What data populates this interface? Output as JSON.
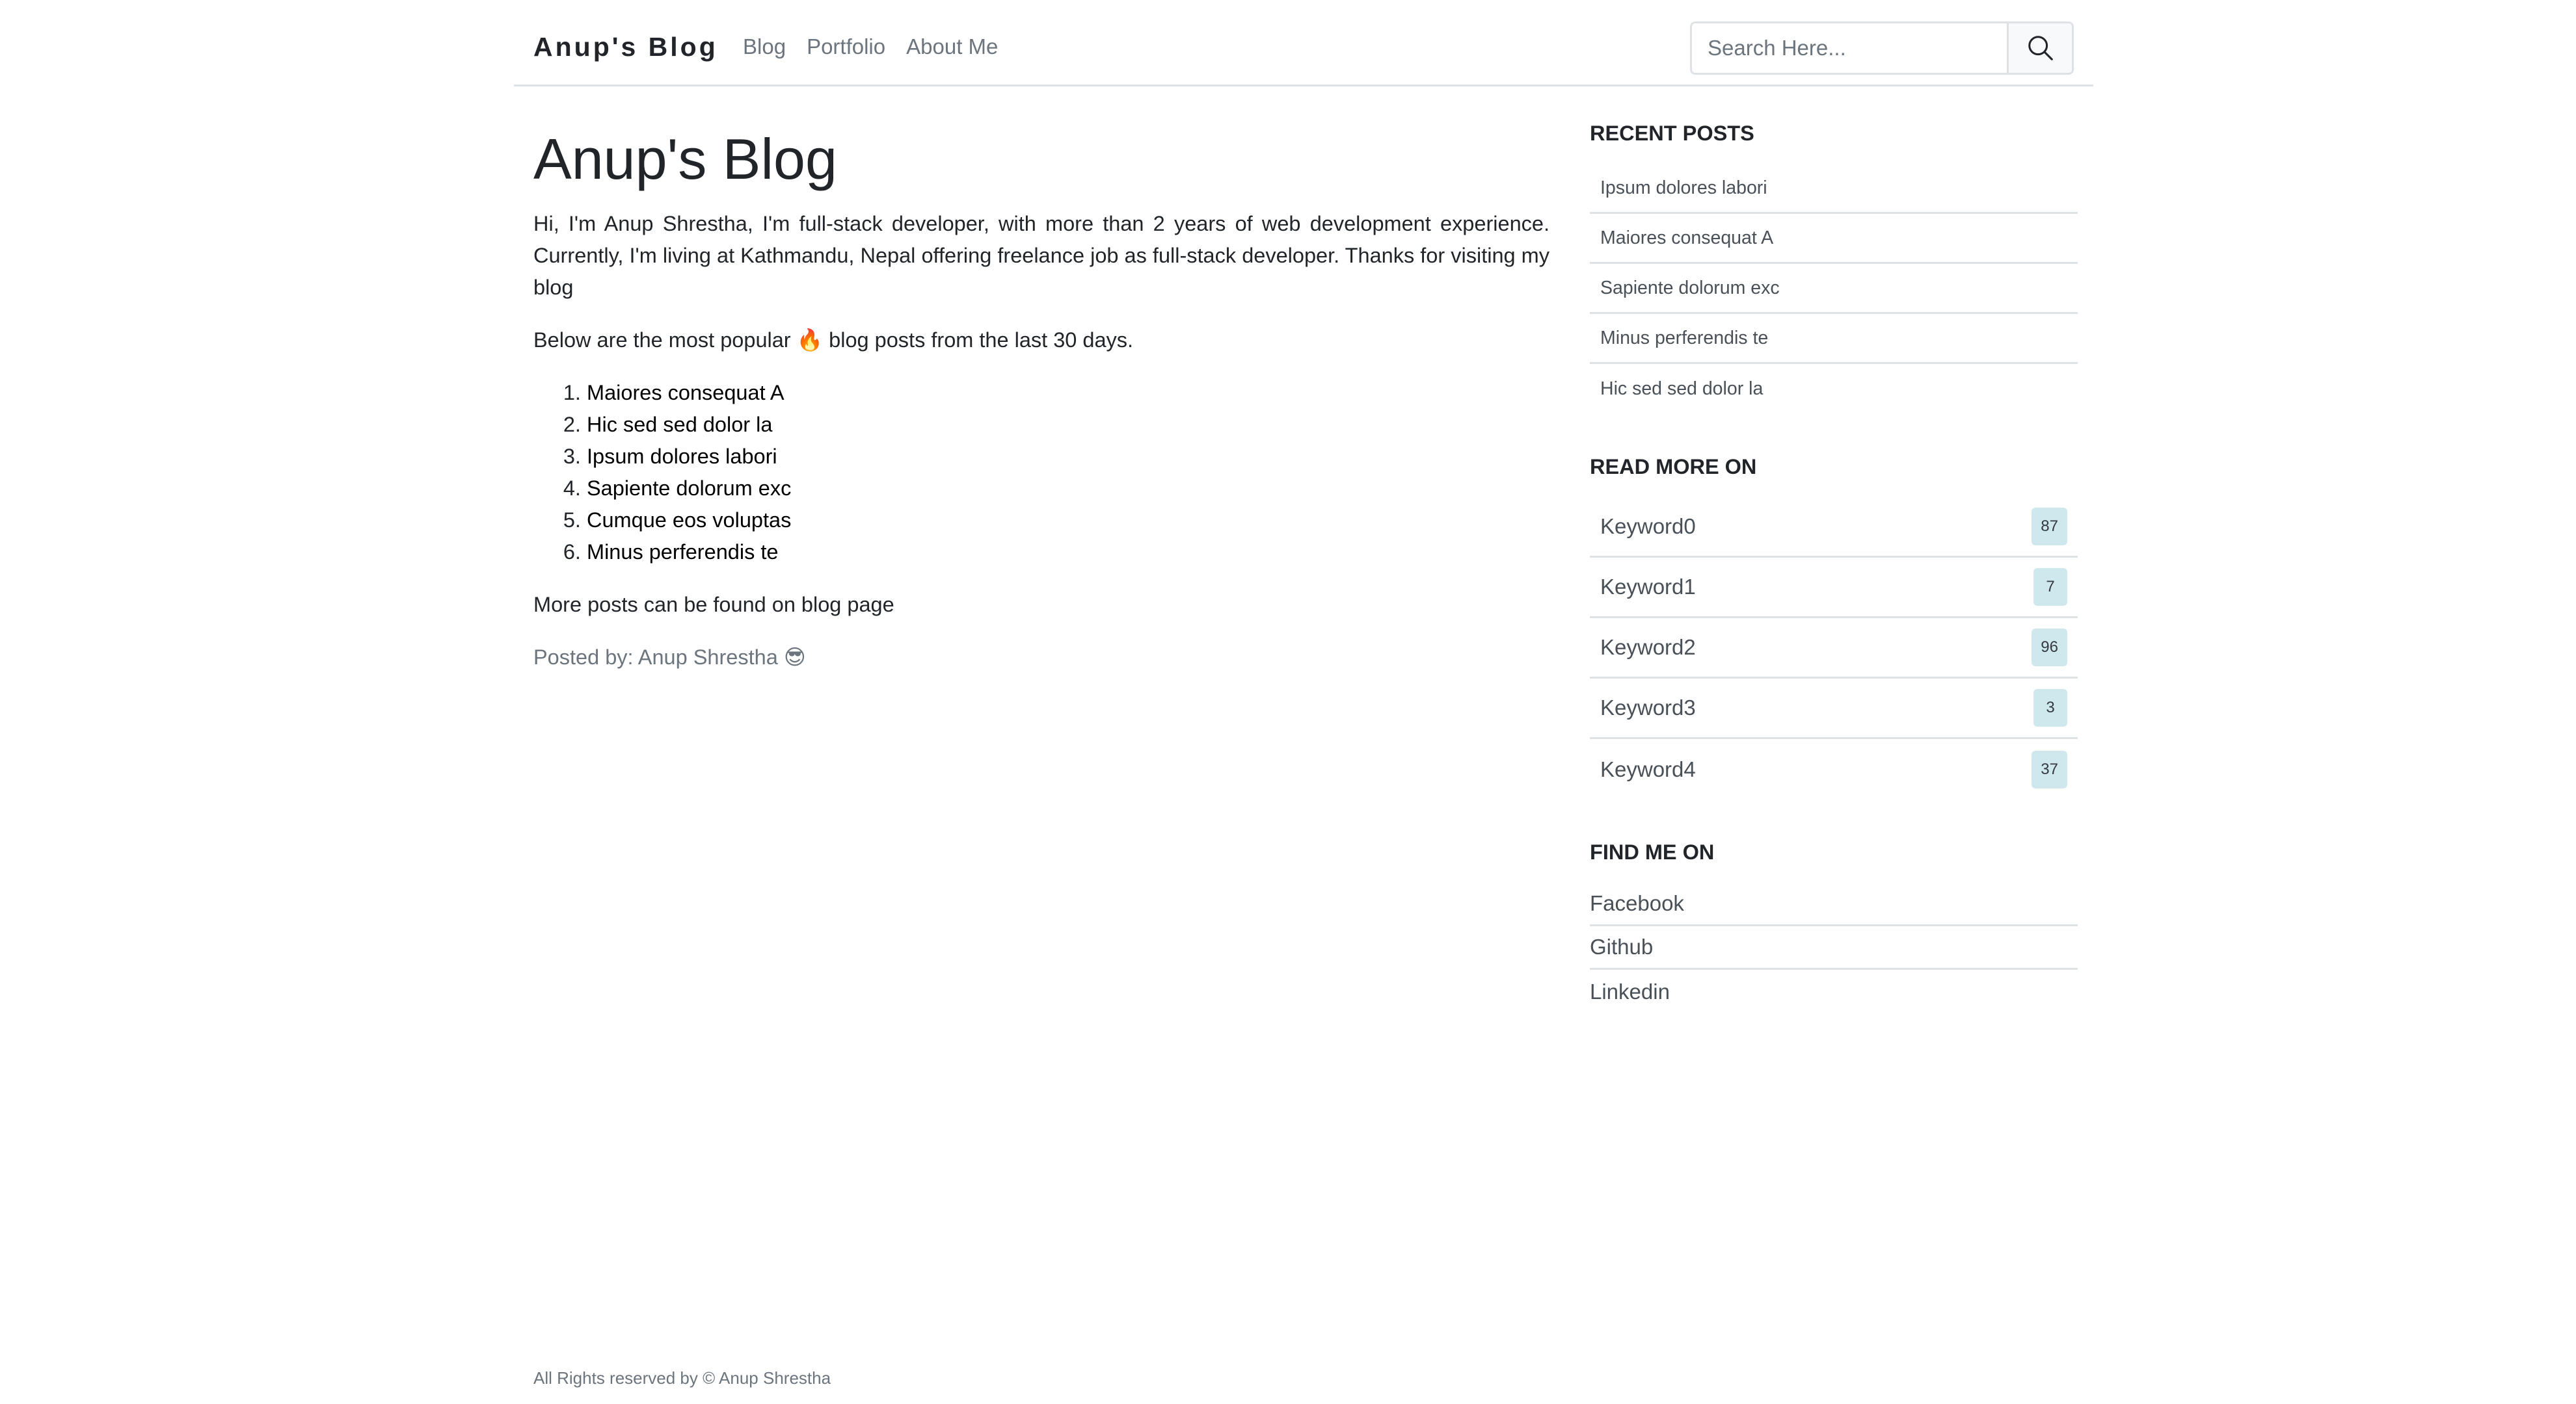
{
  "navbar": {
    "brand": "Anup's Blog",
    "links": [
      "Blog",
      "Portfolio",
      "About Me"
    ],
    "search_placeholder": "Search Here..."
  },
  "main": {
    "title": "Anup's Blog",
    "intro": "Hi, I'm Anup Shrestha, I'm full-stack developer, with more than 2 years of web development experience. Currently, I'm living at Kathmandu, Nepal offering freelance job as full-stack developer. Thanks for visiting my blog",
    "popular_before": "Below are the most popular ",
    "popular_emoji": "🔥",
    "popular_after": " blog posts from the last 30 days.",
    "popular_posts": [
      "Maiores consequat A",
      "Hic sed sed dolor la",
      "Ipsum dolores labori",
      "Sapiente dolorum exc",
      "Cumque eos voluptas",
      "Minus perferendis te"
    ],
    "more_posts": "More posts can be found on blog page",
    "posted_by": "Posted by: Anup Shrestha",
    "posted_by_emoji": "😎"
  },
  "sidebar": {
    "recent_heading": "RECENT POSTS",
    "recent_posts": [
      "Ipsum dolores labori",
      "Maiores consequat A",
      "Sapiente dolorum exc",
      "Minus perferendis te",
      "Hic sed sed dolor la"
    ],
    "read_more_heading": "READ MORE ON",
    "keywords": [
      {
        "name": "Keyword0",
        "count": "87"
      },
      {
        "name": "Keyword1",
        "count": "7"
      },
      {
        "name": "Keyword2",
        "count": "96"
      },
      {
        "name": "Keyword3",
        "count": "3"
      },
      {
        "name": "Keyword4",
        "count": "37"
      }
    ],
    "find_me_heading": "FIND ME ON",
    "social": [
      "Facebook",
      "Github",
      "Linkedin"
    ]
  },
  "footer": {
    "text": "All Rights reserved by © Anup Shrestha"
  },
  "icons": {
    "search": "search-icon"
  },
  "colors": {
    "muted_text": "#6c757d",
    "badge_bg": "#cfe8ee",
    "divider": "#dee2e6"
  }
}
